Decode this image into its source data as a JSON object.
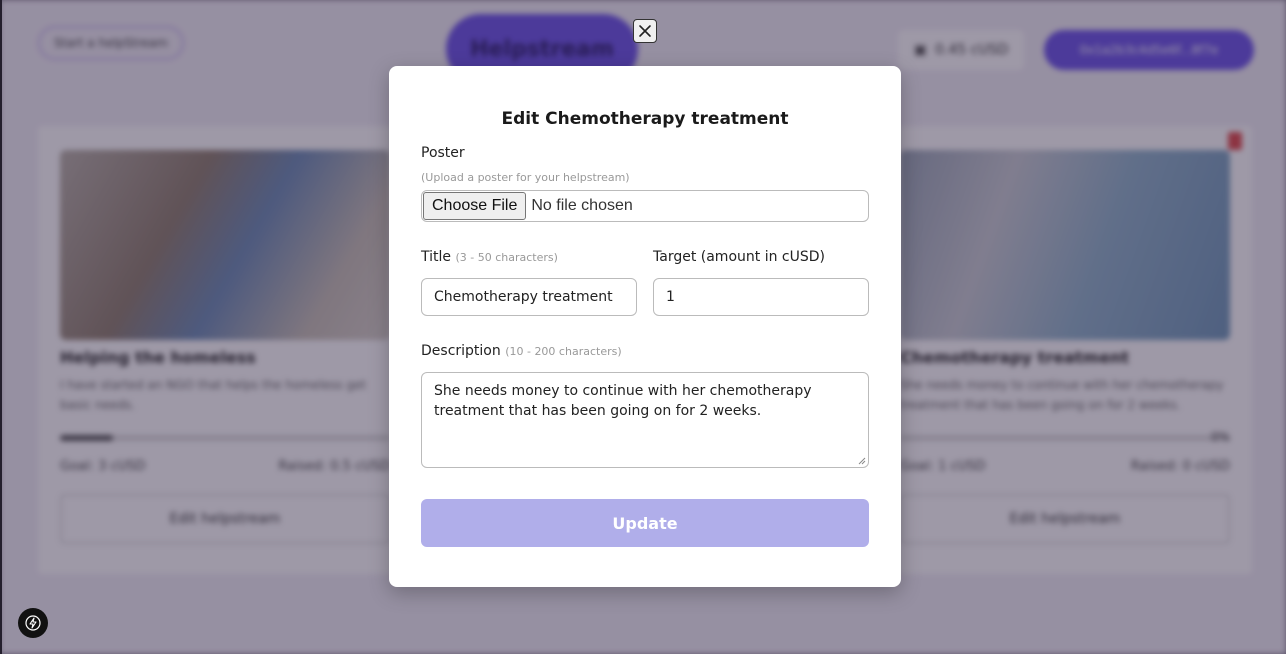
{
  "background": {
    "start_button": "Start a helpStream",
    "logo": "Helpstream",
    "balance": "0.45 cUSD",
    "wallet": "0x1a2b3c4d5e6f...8f7e",
    "cards": [
      {
        "title": "Helping the homeless",
        "description": "I have started an NGO that helps the homeless get basic needs.",
        "goal": "Goal: 3 cUSD",
        "raised": "Raised: 0.5 cUSD",
        "progress": 0.16,
        "edit_label": "Edit helpstream"
      },
      {
        "title": "Chemotherapy treatment",
        "description": "She needs money to continue with her chemotherapy treatment that has been going on for 2 weeks.",
        "goal": "Goal: 1 cUSD",
        "raised": "Raised: 0 cUSD",
        "percent": "0%",
        "progress": 0,
        "edit_label": "Edit helpstream"
      }
    ]
  },
  "modal": {
    "title": "Edit Chemotherapy treatment",
    "poster": {
      "label": "Poster",
      "hint": "(Upload a poster for your helpstream)",
      "choose_label": "Choose File",
      "status": "No file chosen"
    },
    "title_field": {
      "label": "Title",
      "hint": "(3 - 50 characters)",
      "value": "Chemotherapy treatment"
    },
    "target_field": {
      "label": "Target (amount in cUSD)",
      "value": "1"
    },
    "description_field": {
      "label": "Description",
      "hint": "(10 - 200 characters)",
      "value": "She needs money to continue with her chemotherapy treatment that has been going on for 2 weeks."
    },
    "update_label": "Update"
  },
  "colors": {
    "accent": "#6a52e8",
    "update_disabled": "#b0aeea"
  },
  "icons": [
    "close-icon",
    "bolt-icon",
    "wallet-icon",
    "trash-icon"
  ]
}
